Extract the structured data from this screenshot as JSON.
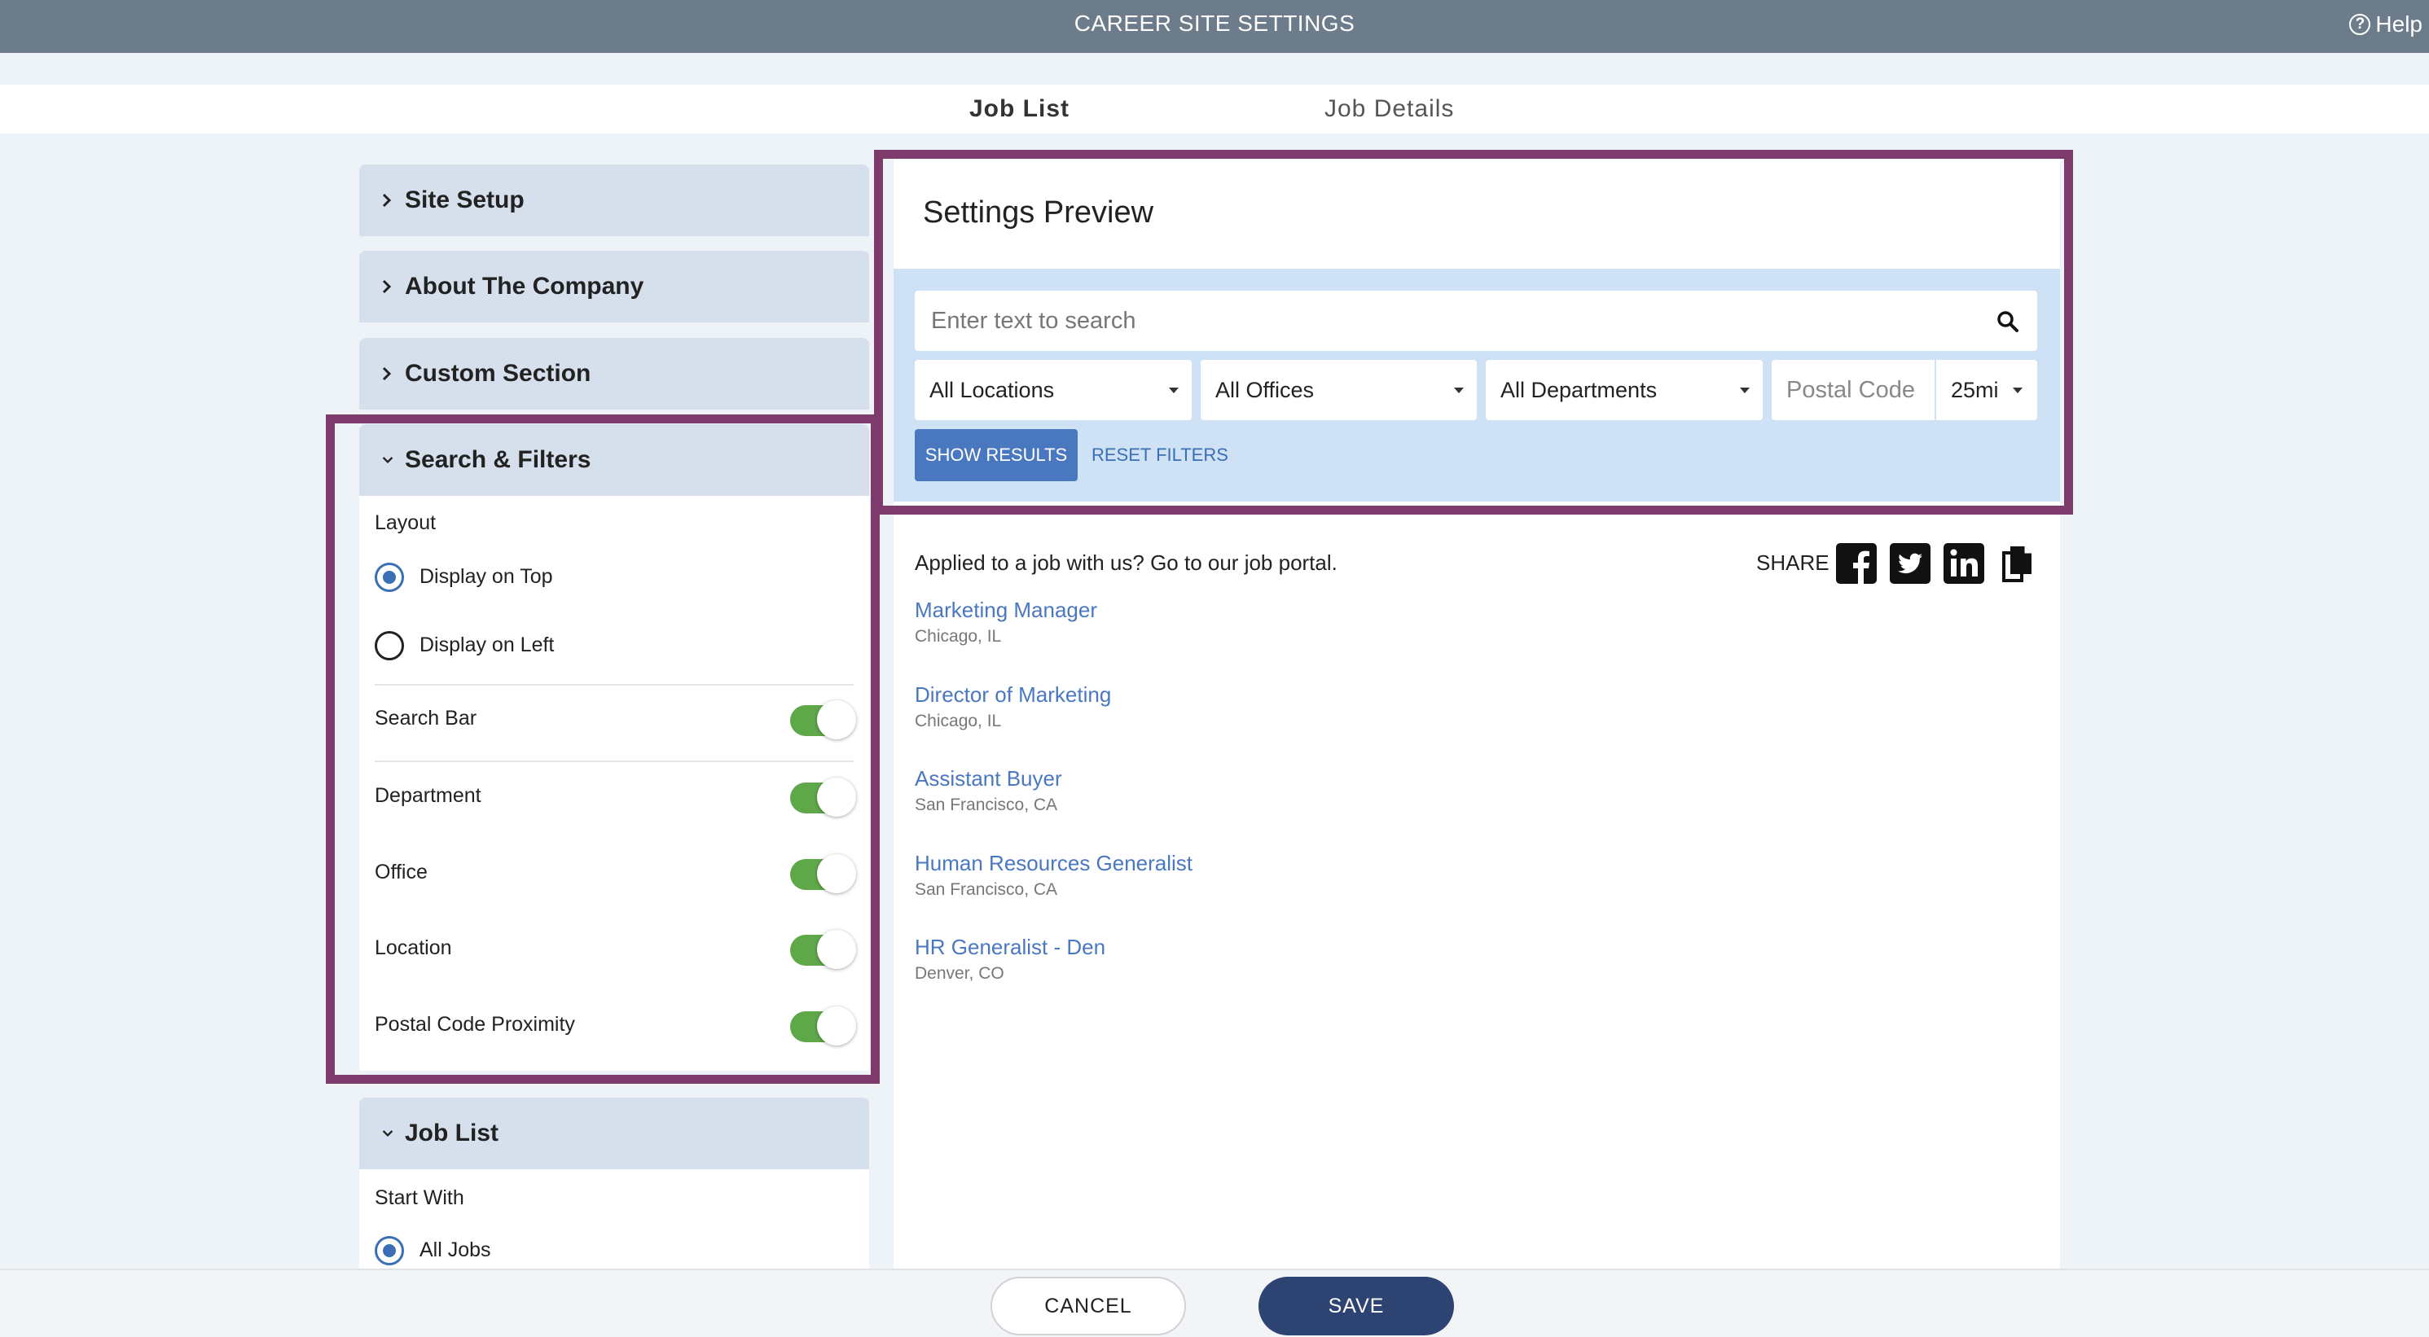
{
  "app": {
    "title": "CAREER SITE SETTINGS",
    "help_label": "Help"
  },
  "tabs": [
    {
      "label": "Job List",
      "active": true
    },
    {
      "label": "Job Details",
      "active": false
    }
  ],
  "sidebar": {
    "sections": [
      {
        "label": "Site Setup",
        "expanded": false
      },
      {
        "label": "About The Company",
        "expanded": false
      },
      {
        "label": "Custom Section",
        "expanded": false
      },
      {
        "label": "Search & Filters",
        "expanded": true
      },
      {
        "label": "Job List",
        "expanded": true
      }
    ],
    "search_filters": {
      "layout_label": "Layout",
      "layout_options": [
        {
          "label": "Display on Top",
          "selected": true
        },
        {
          "label": "Display on Left",
          "selected": false
        }
      ],
      "toggles": [
        {
          "label": "Search Bar",
          "on": true
        },
        {
          "label": "Department",
          "on": true
        },
        {
          "label": "Office",
          "on": true
        },
        {
          "label": "Location",
          "on": true
        },
        {
          "label": "Postal Code Proximity",
          "on": true
        }
      ]
    },
    "job_list": {
      "start_with_label": "Start With",
      "options": [
        {
          "label": "All Jobs",
          "selected": true
        }
      ]
    }
  },
  "preview": {
    "title": "Settings Preview",
    "search_placeholder": "Enter text to search",
    "filters": {
      "locations": "All Locations",
      "offices": "All Offices",
      "departments": "All Departments",
      "postal_placeholder": "Postal Code",
      "radius": "25mi"
    },
    "show_results": "SHOW RESULTS",
    "reset_filters": "RESET FILTERS",
    "applied_text": "Applied to a job with us? Go to our job portal.",
    "share_label": "SHARE",
    "share_icons": [
      "facebook-icon",
      "twitter-icon",
      "linkedin-icon",
      "copy-icon"
    ],
    "jobs": [
      {
        "title": "Marketing Manager",
        "location": "Chicago, IL"
      },
      {
        "title": "Director of Marketing",
        "location": "Chicago, IL"
      },
      {
        "title": "Assistant Buyer",
        "location": "San Francisco, CA"
      },
      {
        "title": "Human Resources Generalist",
        "location": "San Francisco, CA"
      },
      {
        "title": "HR Generalist - Den",
        "location": "Denver, CO"
      }
    ]
  },
  "footer": {
    "cancel": "CANCEL",
    "save": "SAVE"
  },
  "colors": {
    "topbar": "#6c7c8a",
    "highlight": "#7d3b6b",
    "toggle_on": "#5fa84a",
    "link": "#4a78c0",
    "save_button": "#2d4372",
    "preview_band": "#cfe1f4"
  }
}
